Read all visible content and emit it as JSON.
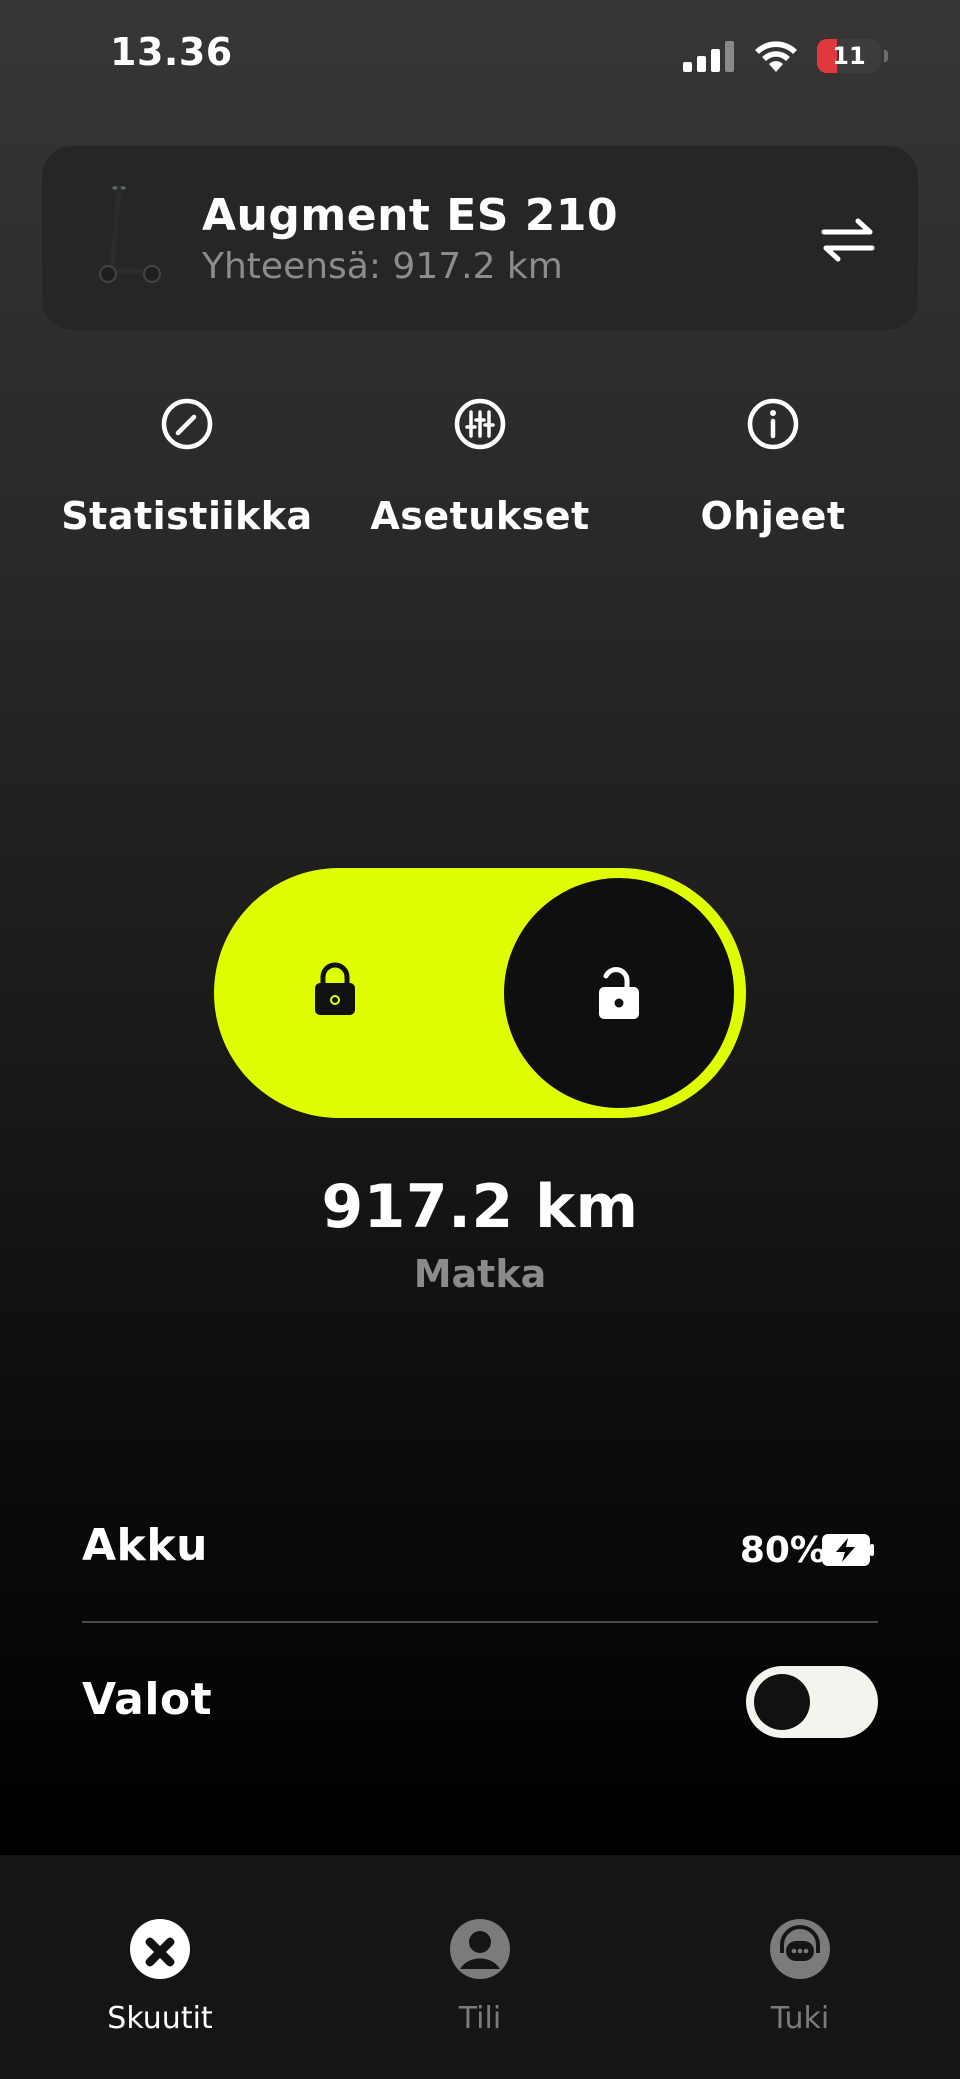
{
  "status_bar": {
    "time": "13.36",
    "battery_level": "11",
    "battery_fraction": 0.11,
    "battery_color": "#e0383e",
    "icons": [
      "cellular-signal-icon",
      "wifi-icon",
      "battery-icon"
    ]
  },
  "scooter": {
    "name": "Augment ES 210",
    "total": "Yhteensä: 917.2 km",
    "icons": [
      "scooter-thumbnail",
      "swap-arrows-icon"
    ]
  },
  "quick_actions": [
    {
      "label": "Statistiikka",
      "icon": "speedometer-icon"
    },
    {
      "label": "Asetukset",
      "icon": "sliders-icon"
    },
    {
      "label": "Ohjeet",
      "icon": "info-icon"
    }
  ],
  "lock": {
    "state": "unlocked",
    "accent_color": "#dfff00",
    "icons": [
      "lock-closed-icon",
      "lock-open-icon"
    ]
  },
  "trip": {
    "distance": "917.2 km",
    "label": "Matka"
  },
  "battery": {
    "label": "Akku",
    "value": "80%",
    "icon": "battery-charging-icon"
  },
  "lights": {
    "label": "Valot",
    "enabled": false
  },
  "bottom_nav": [
    {
      "label": "Skuutit",
      "icon": "scooter-brand-icon",
      "active": true
    },
    {
      "label": "Tili",
      "icon": "account-icon",
      "active": false
    },
    {
      "label": "Tuki",
      "icon": "support-chat-icon",
      "active": false
    }
  ]
}
